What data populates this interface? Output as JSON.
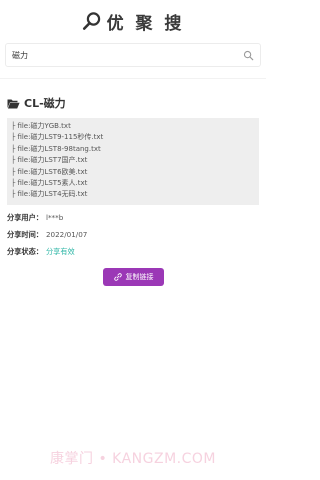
{
  "header": {
    "title": "优 聚 搜",
    "logo_icon": "magnifier-icon"
  },
  "search": {
    "value": "磁力",
    "placeholder": "",
    "button_icon": "search-icon"
  },
  "folder": {
    "icon": "folder-open-icon",
    "name": "CL-磁力"
  },
  "files": [
    "├ file:磁力YGB.txt",
    "├ file:磁力LST9-115秒传.txt",
    "├ file:磁力LST8-98tang.txt",
    "├ file:磁力LST7国产.txt",
    "├ file:磁力LST6欧美.txt",
    "├ file:磁力LST5素人.txt",
    "├ file:磁力LST4无码.txt"
  ],
  "share": {
    "user_label": "分享用户：",
    "user_value": "l***b",
    "time_label": "分享时间：",
    "time_value": "2022/01/07",
    "status_label": "分享状态：",
    "status_value": "分享有效"
  },
  "copy_button": {
    "label": "复制链接",
    "icon": "link-icon"
  },
  "watermark": "康掌门 • KANGZM.COM",
  "colors": {
    "accent": "#9b38b6",
    "status_ok": "#2bb5a5",
    "file_box_bg": "#eeeeee",
    "watermark": "#f4c3d5"
  }
}
